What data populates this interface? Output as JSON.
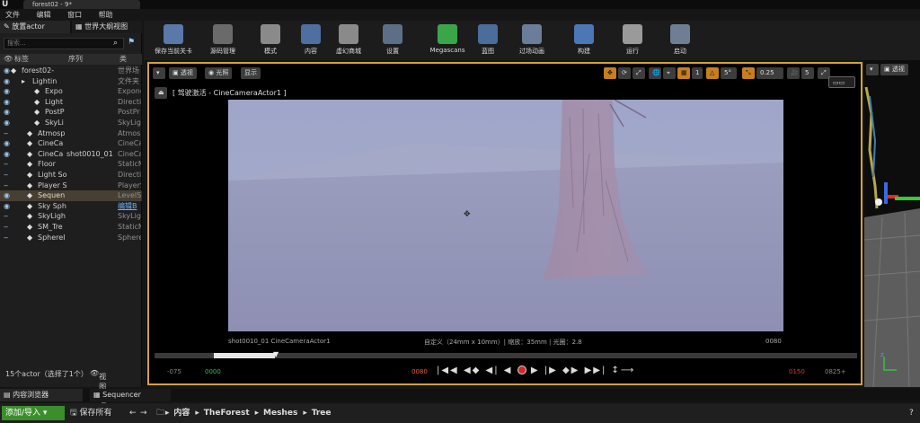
{
  "window": {
    "tab_title": "forest02 - 9*"
  },
  "menu": [
    "文件",
    "编辑",
    "窗口",
    "帮助"
  ],
  "left": {
    "tab_place": "放置actor",
    "tab_outliner": "世界大纲视图",
    "search_placeholder": "搜索...",
    "col_label": "标签",
    "col_seq": "序列",
    "col_type": "类",
    "rows": [
      {
        "label": "forest02-",
        "type": "世界场",
        "indent": 14
      },
      {
        "label": "Lightin",
        "type": "文件夹",
        "indent": 26
      },
      {
        "label": "Expo",
        "type": "Expone",
        "indent": 40
      },
      {
        "label": "Light",
        "type": "Directi",
        "indent": 40
      },
      {
        "label": "PostP",
        "type": "PostPr",
        "indent": 40
      },
      {
        "label": "SkyLi",
        "type": "SkyLig",
        "indent": 40
      },
      {
        "label": "Atmosp",
        "type": "Atmosp",
        "indent": 32
      },
      {
        "label": "CineCa",
        "type": "CineCa",
        "indent": 32
      },
      {
        "label": "CineCa",
        "seq": "shot0010_01",
        "type": "CineCa",
        "indent": 32
      },
      {
        "label": "Floor",
        "type": "StaticM",
        "indent": 32
      },
      {
        "label": "Light So",
        "type": "Directi",
        "indent": 32
      },
      {
        "label": "Player S",
        "type": "PlayerS",
        "indent": 32
      },
      {
        "label": "Sequen",
        "type": "LevelSe",
        "indent": 32,
        "selected": true
      },
      {
        "label": "Sky Sph",
        "type": "编辑B",
        "indent": 32,
        "link": true
      },
      {
        "label": "SkyLigh",
        "type": "SkyLig",
        "indent": 32
      },
      {
        "label": "SM_Tre",
        "type": "StaticM",
        "indent": 32
      },
      {
        "label": "SphereI",
        "type": "Sphere",
        "indent": 32
      }
    ],
    "footer_count": "15个actor（选择了1个）",
    "footer_view": "视图选项"
  },
  "toolbar": [
    {
      "label": "保存当前关卡",
      "color": "#5a78a8"
    },
    {
      "label": "源码管理",
      "color": "#6a6a6a"
    },
    {
      "label": "模式",
      "color": "#8a8a8a"
    },
    {
      "label": "内容",
      "color": "#4e6fa0"
    },
    {
      "label": "虚幻商城",
      "color": "#8a8a8a"
    },
    {
      "label": "设置",
      "color": "#5d6f86"
    },
    {
      "label": "Megascans",
      "color": "#3aa64a"
    },
    {
      "label": "蓝图",
      "color": "#4a6d9a"
    },
    {
      "label": "过场动画",
      "color": "#6a7d99"
    },
    {
      "label": "构建",
      "color": "#4b78b5"
    },
    {
      "label": "运行",
      "color": "#9a9a9a"
    },
    {
      "label": "启动",
      "color": "#6f7f93"
    }
  ],
  "viewport": {
    "btn_perspective": "透视",
    "btn_lit": "光照",
    "btn_show": "显示",
    "pilot_text": "[ 驾驶激活 - CineCameraActor1 ]",
    "snap_angle": "5°",
    "snap_scale": "0.25",
    "cam_speed": "5",
    "cam_name": "shot0010_01  CineCameraActor1",
    "cam_settings": "自定义（24mm x 10mm）| 缩放：35mm | 光圈：2.8",
    "frame_end": "0080",
    "tl_start_out": "-075",
    "tl_start": "0000",
    "tl_current": "0080",
    "tl_end": "0150",
    "tl_end_out": "0825+",
    "right_perspective": "透视"
  },
  "bottom": {
    "tab_content": "内容浏览器",
    "tab_sequencer": "Sequencer",
    "add_import": "添加/导入",
    "save_all": "保存所有",
    "path": [
      "内容",
      "TheForest",
      "Meshes",
      "Tree"
    ]
  }
}
